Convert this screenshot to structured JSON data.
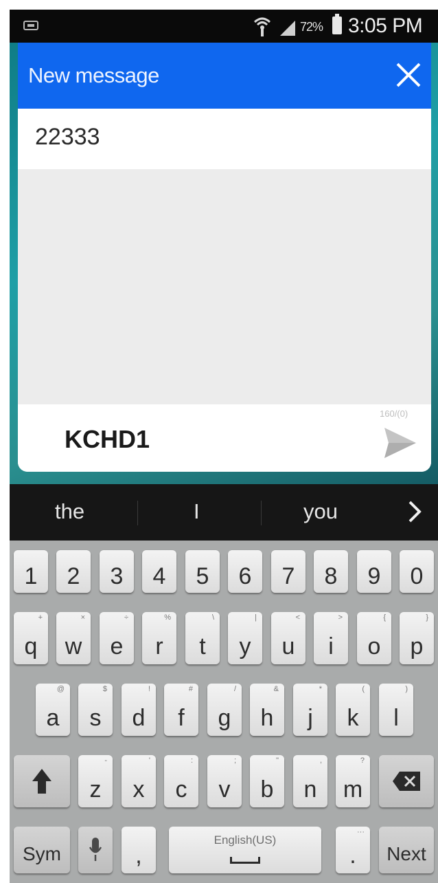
{
  "status_bar": {
    "battery_percent": "72%",
    "time": "3:05 PM",
    "icons": [
      "notification-icon",
      "wifi-icon",
      "signal-icon",
      "battery-icon"
    ]
  },
  "dialog": {
    "title": "New message",
    "close_icon": "close-icon",
    "recipient": "22333",
    "message_text": "KCHD1",
    "char_counter": "160/(0)",
    "send_icon": "send-icon"
  },
  "suggestions": [
    "the",
    "I",
    "you"
  ],
  "keyboard": {
    "number_row": [
      "1",
      "2",
      "3",
      "4",
      "5",
      "6",
      "7",
      "8",
      "9",
      "0"
    ],
    "row_q": [
      {
        "label": "q",
        "hint": "+"
      },
      {
        "label": "w",
        "hint": "×"
      },
      {
        "label": "e",
        "hint": "÷"
      },
      {
        "label": "r",
        "hint": "%"
      },
      {
        "label": "t",
        "hint": "\\"
      },
      {
        "label": "y",
        "hint": "|"
      },
      {
        "label": "u",
        "hint": "<"
      },
      {
        "label": "i",
        "hint": ">"
      },
      {
        "label": "o",
        "hint": "{"
      },
      {
        "label": "p",
        "hint": "}"
      }
    ],
    "row_a": [
      {
        "label": "a",
        "hint": "@"
      },
      {
        "label": "s",
        "hint": "$"
      },
      {
        "label": "d",
        "hint": "!"
      },
      {
        "label": "f",
        "hint": "#"
      },
      {
        "label": "g",
        "hint": "/"
      },
      {
        "label": "h",
        "hint": "&"
      },
      {
        "label": "j",
        "hint": "*"
      },
      {
        "label": "k",
        "hint": "("
      },
      {
        "label": "l",
        "hint": ")"
      }
    ],
    "row_z": [
      {
        "label": "z",
        "hint": "-"
      },
      {
        "label": "x",
        "hint": "'"
      },
      {
        "label": "c",
        "hint": ":"
      },
      {
        "label": "v",
        "hint": ";"
      },
      {
        "label": "b",
        "hint": "\""
      },
      {
        "label": "n",
        "hint": ","
      },
      {
        "label": "m",
        "hint": "?"
      }
    ],
    "shift_icon": "shift-icon",
    "backspace_icon": "backspace-icon",
    "sym_label": "Sym",
    "mic_icon": "microphone-icon",
    "comma_label": ",",
    "space_label": "English(US)",
    "period_label": ".",
    "period_hint": "···",
    "next_label": "Next"
  }
}
